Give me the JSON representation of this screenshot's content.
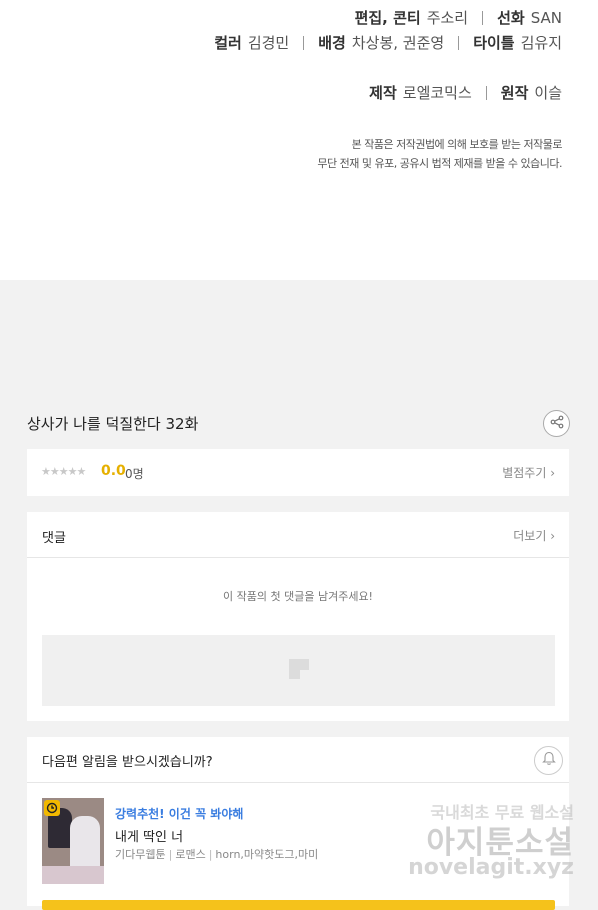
{
  "credits": {
    "line1": [
      {
        "role": "편집, 콘티",
        "name": "주소리"
      },
      {
        "role": "선화",
        "name": "SAN"
      }
    ],
    "line2": [
      {
        "role": "컬러",
        "name": "김경민"
      },
      {
        "role": "배경",
        "name": "차상봉, 권준영"
      },
      {
        "role": "타이틀",
        "name": "김유지"
      }
    ],
    "line3": [
      {
        "role": "제작",
        "name": "로엘코믹스"
      },
      {
        "role": "원작",
        "name": "이슬"
      }
    ]
  },
  "copyright": {
    "line1": "본 작품은 저작권법에 의해 보호를 받는 저작물로",
    "line2": "무단 전재 및 유포, 공유시 법적 제재를 받을 수 있습니다."
  },
  "episode": {
    "title": "상사가 나를 덕질한다 32화",
    "share_icon": "share-icon"
  },
  "rating": {
    "stars": "★★★★★",
    "score": "0.0",
    "count": "0명",
    "rate_link": "별점주기 ›",
    "star_color": "#c8c8c8",
    "score_color": "#e6b000"
  },
  "comments": {
    "title": "댓글",
    "more_link": "더보기 ›",
    "empty_text": "이 작품의 첫 댓글을 남겨주세요!"
  },
  "notify": {
    "question": "다음편 알림을 받으시겠습니까?",
    "bell_icon": "bell-icon"
  },
  "recommendation": {
    "tag": "강력추천! 이건 꼭 봐야해",
    "title": "내게 딱인 너",
    "meta": [
      "기다무웹툰",
      "로맨스",
      "horn,마약핫도그,마미"
    ],
    "tag_color": "#3a7de0",
    "button_color": "#f5c21b"
  },
  "watermark": {
    "line1": "국내최초 무료 웹소설",
    "line2": "아지툰소설",
    "line3": "novelagit.xyz"
  }
}
